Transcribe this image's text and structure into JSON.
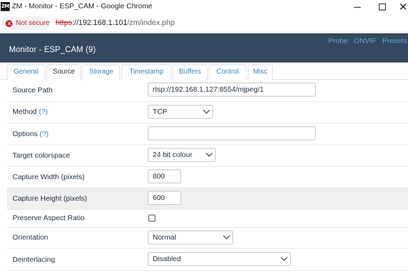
{
  "window": {
    "logo_text": "ZM",
    "title": "ZM - Monitor - ESP_CAM - Google Chrome"
  },
  "address_bar": {
    "security_label": "Not secure",
    "url_protocol": "https",
    "url_host": "://192.168.1.101",
    "url_path": "/zm/index.php"
  },
  "header": {
    "title": "Monitor - ESP_CAM (9)",
    "links": [
      "Probe",
      "ONVIF",
      "Presets"
    ]
  },
  "tabs": [
    {
      "label": "General",
      "active": false
    },
    {
      "label": "Source",
      "active": true
    },
    {
      "label": "Storage",
      "active": false
    },
    {
      "label": "Timestamp",
      "active": false
    },
    {
      "label": "Buffers",
      "active": false
    },
    {
      "label": "Control",
      "active": false
    },
    {
      "label": "Misc",
      "active": false
    }
  ],
  "form": {
    "source_path": {
      "label": "Source Path",
      "value": "rtsp://192.168.1.127:8554/mjpeg/1"
    },
    "method": {
      "label": "Method",
      "help": "(?)",
      "value": "TCP"
    },
    "options": {
      "label": "Options",
      "help": "(?)",
      "value": ""
    },
    "target_colorspace": {
      "label": "Target colorspace",
      "value": "24 bit colour"
    },
    "capture_width": {
      "label": "Capture Width (pixels)",
      "value": "800"
    },
    "capture_height": {
      "label": "Capture Height (pixels)",
      "value": "600"
    },
    "preserve_aspect": {
      "label": "Preserve Aspect Ratio",
      "checked": false
    },
    "orientation": {
      "label": "Orientation",
      "value": "Normal"
    },
    "deinterlacing": {
      "label": "Deinterlacing",
      "value": "Disabled"
    }
  },
  "colors": {
    "header_bg": "#34495e",
    "link": "#2e86c1",
    "not_secure": "#c5221f"
  }
}
